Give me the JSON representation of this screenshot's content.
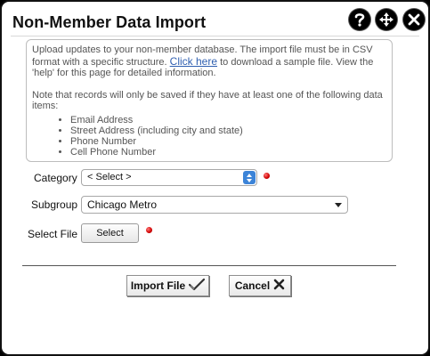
{
  "dialog": {
    "title": "Non-Member Data Import",
    "controls": {
      "help_icon": "question-icon",
      "move_icon": "move-arrows-icon",
      "close_icon": "close-icon"
    }
  },
  "info": {
    "intro_before_link": "Upload updates to your non-member database. The import file must be in CSV format with a specific structure. ",
    "link_text": "Click here",
    "intro_after_link": " to download a sample file. View the 'help' for this page for detailed information.",
    "note": "Note that records will only be saved if they have at least one of the following data items:",
    "items": [
      "Email Address",
      "Street Address (including city and state)",
      "Phone Number",
      "Cell Phone Number"
    ]
  },
  "form": {
    "category_label": "Category",
    "category_value": "< Select >",
    "subgroup_label": "Subgroup",
    "subgroup_value": "Chicago Metro",
    "file_label": "Select File",
    "file_button": "Select"
  },
  "actions": {
    "import_label": "Import File",
    "cancel_label": "Cancel",
    "import_icon": "checkmark-icon",
    "cancel_icon": "x-icon"
  },
  "colors": {
    "required_marker": "#d00000",
    "link": "#2f5fb0",
    "select_accent": "#3c84d8"
  }
}
